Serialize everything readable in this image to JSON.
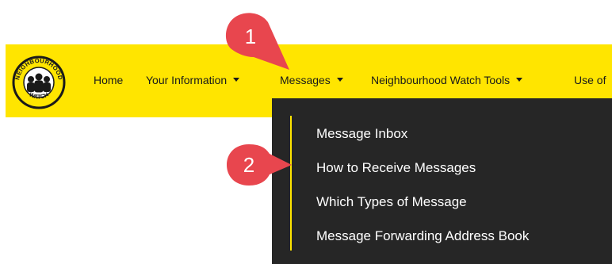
{
  "navbar": {
    "logo_text": [
      "NEIGHBOURHOOD",
      "WATCH"
    ],
    "items": [
      {
        "label": "Home",
        "has_caret": false
      },
      {
        "label": "Your Information",
        "has_caret": true
      },
      {
        "label": "Messages",
        "has_caret": true
      },
      {
        "label": "Neighbourhood Watch Tools",
        "has_caret": true
      },
      {
        "label": "Use of",
        "has_caret": false
      }
    ]
  },
  "dropdown": {
    "items": [
      {
        "label": "Message Inbox"
      },
      {
        "label": "How to Receive Messages"
      },
      {
        "label": "Which Types of Message"
      },
      {
        "label": "Message Forwarding Address Book"
      }
    ]
  },
  "callouts": [
    {
      "number": "1"
    },
    {
      "number": "2"
    }
  ],
  "colors": {
    "navbar_bg": "#ffe500",
    "dropdown_bg": "#262626",
    "callout": "#e8464e"
  }
}
